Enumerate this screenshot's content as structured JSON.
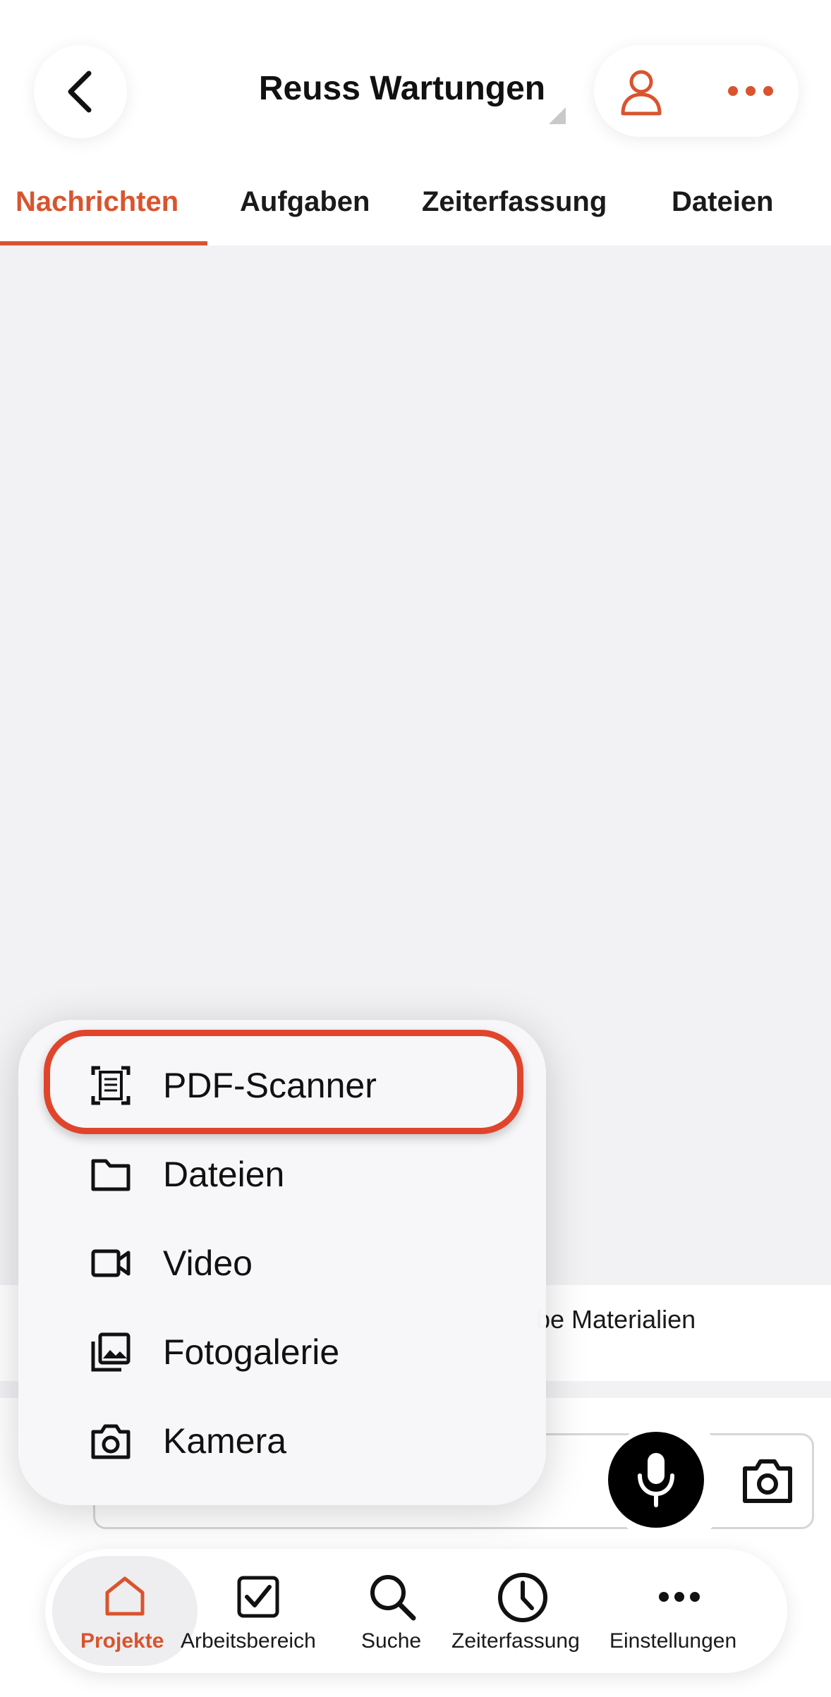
{
  "header": {
    "title": "Reuss Wartungen",
    "back_icon": "chevron-left-icon",
    "person_icon": "person-icon",
    "more_icon": "more-dots-icon"
  },
  "tabs": [
    {
      "label": "Nachrichten",
      "active": true
    },
    {
      "label": "Aufgaben",
      "active": false
    },
    {
      "label": "Zeiterfassung",
      "active": false
    },
    {
      "label": "Dateien",
      "active": false
    }
  ],
  "info_text": "be Materialien",
  "menu": {
    "items": [
      {
        "label": "PDF-Scanner",
        "icon": "document-scan-icon",
        "highlighted": true
      },
      {
        "label": "Dateien",
        "icon": "folder-icon"
      },
      {
        "label": "Video",
        "icon": "video-camera-icon"
      },
      {
        "label": "Fotogalerie",
        "icon": "photo-gallery-icon"
      },
      {
        "label": "Kamera",
        "icon": "camera-icon"
      }
    ]
  },
  "composer": {
    "mic_icon": "microphone-icon",
    "camera_icon": "camera-icon"
  },
  "bottom_nav": [
    {
      "label": "Projekte",
      "icon": "home-icon",
      "active": true
    },
    {
      "label": "Arbeitsbereich",
      "icon": "checkbox-icon"
    },
    {
      "label": "Suche",
      "icon": "search-icon"
    },
    {
      "label": "Zeiterfassung",
      "icon": "clock-icon"
    },
    {
      "label": "Einstellungen",
      "icon": "more-dots-icon"
    }
  ],
  "colors": {
    "accent": "#d9542e",
    "highlight": "#e0452c",
    "content_bg": "#f2f2f5"
  }
}
